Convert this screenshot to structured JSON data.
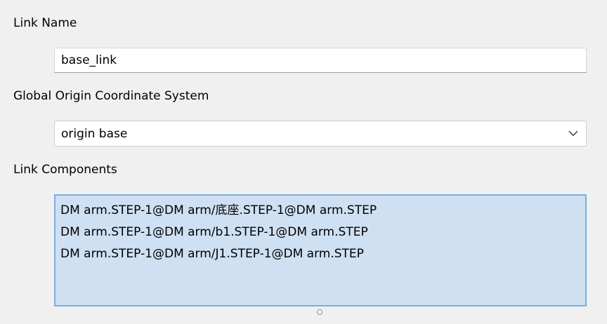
{
  "link_name": {
    "label": "Link Name",
    "value": "base_link"
  },
  "origin": {
    "label": "Global Origin Coordinate System",
    "selected": "origin base",
    "icon": "chevron-down-icon"
  },
  "components": {
    "label": "Link Components",
    "items": [
      "DM arm.STEP-1@DM arm/底座.STEP-1@DM arm.STEP",
      "DM arm.STEP-1@DM arm/b1.STEP-1@DM arm.STEP",
      "DM arm.STEP-1@DM arm/J1.STEP-1@DM arm.STEP"
    ]
  },
  "colors": {
    "background": "#f0f0f0",
    "list_selection": "#cfe0f3",
    "list_border": "#7aaee0"
  }
}
